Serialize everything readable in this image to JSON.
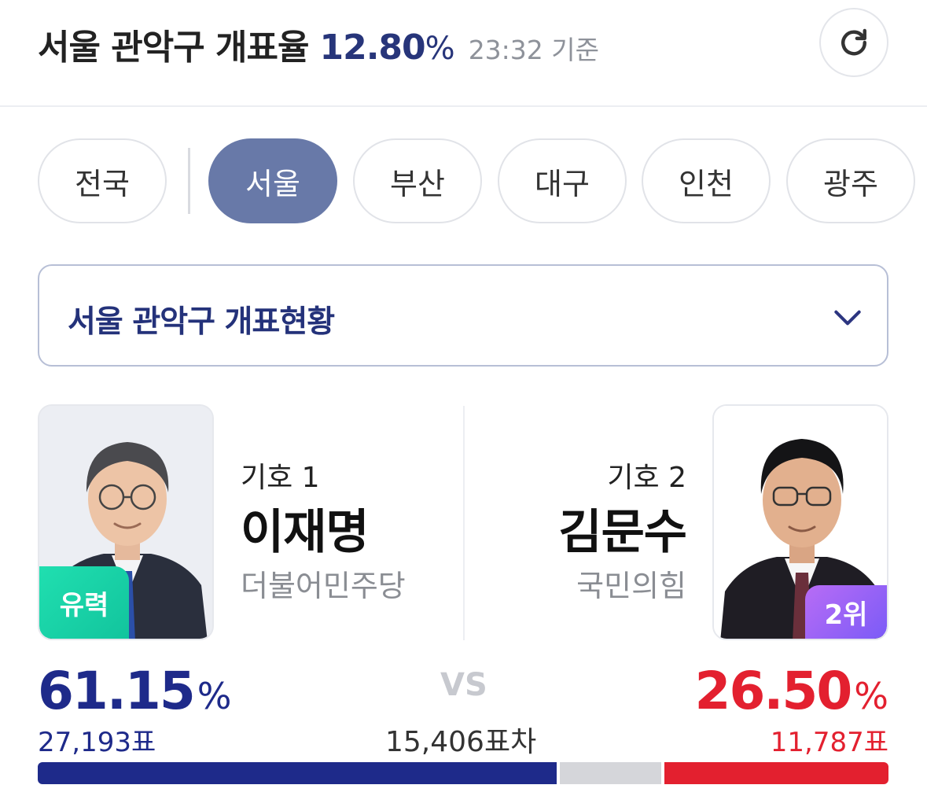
{
  "header": {
    "title": "서울 관악구 개표율",
    "rate_value": "12.80",
    "rate_unit": "%",
    "timestamp": "23:32 기준",
    "refresh_icon": "refresh-icon"
  },
  "regions": {
    "items": [
      {
        "label": "전국",
        "active": false
      },
      {
        "label": "서울",
        "active": true
      },
      {
        "label": "부산",
        "active": false
      },
      {
        "label": "대구",
        "active": false
      },
      {
        "label": "인천",
        "active": false
      },
      {
        "label": "광주",
        "active": false
      }
    ]
  },
  "dropdown": {
    "label": "서울 관악구 개표현황",
    "icon": "chevron-down-icon"
  },
  "candidates": {
    "left": {
      "number": "기호 1",
      "name": "이재명",
      "party": "더불어민주당",
      "badge": "유력",
      "percent": "61.15",
      "percent_unit": "%",
      "votes": "27,193표",
      "color": "#1e2a8a"
    },
    "right": {
      "number": "기호 2",
      "name": "김문수",
      "party": "국민의힘",
      "badge": "2위",
      "percent": "26.50",
      "percent_unit": "%",
      "votes": "11,787표",
      "color": "#e3202f"
    }
  },
  "comparison": {
    "vs": "VS",
    "difference": "15,406표차"
  },
  "share_bar": {
    "left_share": 0.6115,
    "right_share": 0.265,
    "left_color": "#1e2a8a",
    "other_color": "#d5d6da",
    "right_color": "#e3202f"
  }
}
